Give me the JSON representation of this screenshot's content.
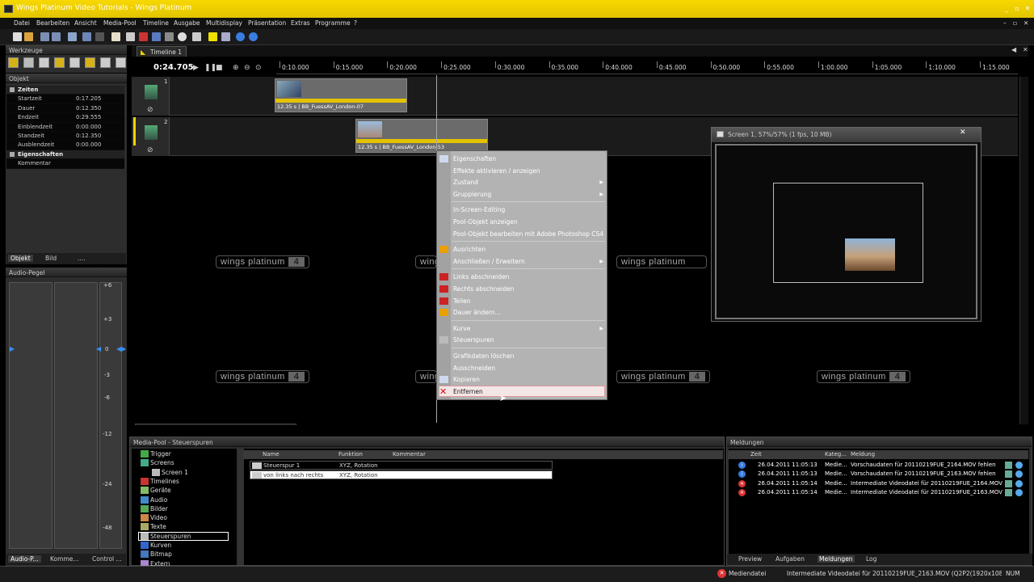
{
  "window": {
    "title": "Wings Platinum Video Tutorials - Wings Platinum"
  },
  "menu": [
    "Datei",
    "Bearbeiten",
    "Ansicht",
    "Media-Pool",
    "Timeline",
    "Ausgabe",
    "Multidisplay",
    "Präsentation",
    "Extras",
    "Programme",
    "?"
  ],
  "werkzeuge": {
    "title": "Werkzeuge"
  },
  "objekt": {
    "title": "Objekt",
    "rows": [
      {
        "cat": true,
        "k": "Zeiten",
        "v": ""
      },
      {
        "k": "Startzeit",
        "v": "0:17.205"
      },
      {
        "k": "Dauer",
        "v": "0:12.350"
      },
      {
        "k": "Endzeit",
        "v": "0:29.555"
      },
      {
        "k": "Einblendzeit",
        "v": "0:00.000"
      },
      {
        "k": "Standzeit",
        "v": "0:12.350"
      },
      {
        "k": "Ausblendzeit",
        "v": "0:00.000"
      },
      {
        "cat": true,
        "k": "Eigenschaften",
        "v": ""
      },
      {
        "k": "Kommentar",
        "v": ""
      }
    ],
    "tabs": [
      "Objekt",
      "Bild",
      "...."
    ]
  },
  "audio": {
    "title": "Audio-Pegel",
    "scale": [
      "+6",
      "+3",
      "0",
      "-3",
      "-6",
      "-12",
      "-24",
      "-48"
    ],
    "tabs": [
      "Audio-P...",
      "Komme...",
      "Control ..."
    ]
  },
  "timeline": {
    "tab": "Timeline 1",
    "time": "0:24.705",
    "ticks": [
      "0:10.000",
      "0:15.000",
      "0:20.000",
      "0:25.000",
      "0:30.000",
      "0:35.000",
      "0:40.000",
      "0:45.000",
      "0:50.000",
      "0:55.000",
      "1:00.000",
      "1:05.000",
      "1:10.000",
      "1:15.000"
    ],
    "tracks": [
      "1",
      "2"
    ],
    "clips": [
      "12.35 s | BB_FuessAV_London-07",
      "12.35 s | BB_FuessAV_London-53"
    ],
    "watermark": "wings platinum",
    "watermark_num": "4"
  },
  "context_menu": {
    "groups": [
      [
        {
          "label": "Eigenschaften"
        },
        {
          "label": "Effekte aktivieren / anzeigen"
        },
        {
          "label": "Zustand",
          "sub": true
        },
        {
          "label": "Gruppierung",
          "sub": true
        }
      ],
      [
        {
          "label": "In-Screen-Editing"
        },
        {
          "label": "Pool-Objekt anzeigen"
        },
        {
          "label": "Pool-Objekt bearbeiten mit Adobe Photoshop CS4"
        }
      ],
      [
        {
          "label": "Ausrichten"
        },
        {
          "label": "Anschließen / Erweitern",
          "sub": true
        }
      ],
      [
        {
          "label": "Links abschneiden"
        },
        {
          "label": "Rechts abschneiden"
        },
        {
          "label": "Teilen"
        },
        {
          "label": "Dauer ändern..."
        }
      ],
      [
        {
          "label": "Kurve",
          "sub": true
        },
        {
          "label": "Steuerspuren"
        }
      ],
      [
        {
          "label": "Grafikdaten löschen"
        },
        {
          "label": "Ausschneiden"
        },
        {
          "label": "Kopieren"
        },
        {
          "label": "Entfernen"
        }
      ]
    ]
  },
  "screen": {
    "title": "Screen 1, 57%/57% (1 fps, 10 MB)"
  },
  "mediapool": {
    "title": "Media-Pool - Steuerspuren",
    "tree": [
      "Trigger",
      "Screens",
      "Screen 1",
      "Timelines",
      "Geräte",
      "Audio",
      "Bilder",
      "Video",
      "Texte",
      "Steuerspuren",
      "Kurven",
      "Bitmap",
      "Extern"
    ],
    "columns": [
      "Name",
      "Funktion",
      "Kommentar"
    ],
    "rows": [
      {
        "name": "Steuerspur 1",
        "fn": "XYZ, Rotation",
        "comment": ""
      },
      {
        "name": "von links nach rechts",
        "fn": "XYZ, Rotation",
        "comment": ""
      }
    ]
  },
  "meldungen": {
    "title": "Meldungen",
    "columns": [
      "Zeit",
      "Kateg...",
      "Meldung"
    ],
    "rows": [
      {
        "type": "info",
        "time": "26.04.2011 11:05:13",
        "cat": "Medie...",
        "msg": "Vorschaudaten für 20110219FUE_2164.MOV fehlen"
      },
      {
        "type": "info",
        "time": "26.04.2011 11:05:13",
        "cat": "Medie...",
        "msg": "Vorschaudaten für 20110219FUE_2163.MOV fehlen"
      },
      {
        "type": "error",
        "time": "26.04.2011 11:05:14",
        "cat": "Medie...",
        "msg": "Intermediate Videodatei für 20110219FUE_2164.MOV (Q..."
      },
      {
        "type": "error",
        "time": "26.04.2011 11:05:14",
        "cat": "Medie...",
        "msg": "Intermediate Videodatei für 20110219FUE_2163.MOV (Q..."
      }
    ],
    "tabs": [
      "Preview",
      "Aufgaben",
      "Meldungen",
      "Log"
    ]
  },
  "status": {
    "left": "Mediendatei",
    "msg": "Intermediate Videodatei für 20110219FUE_2163.MOV (Q2P2(1920x1080)) existie",
    "num": "NUM"
  },
  "colors": {
    "accent": "#f1d200",
    "clip_bar": "#e3c200",
    "menu_bg": "#b3b3b3"
  }
}
